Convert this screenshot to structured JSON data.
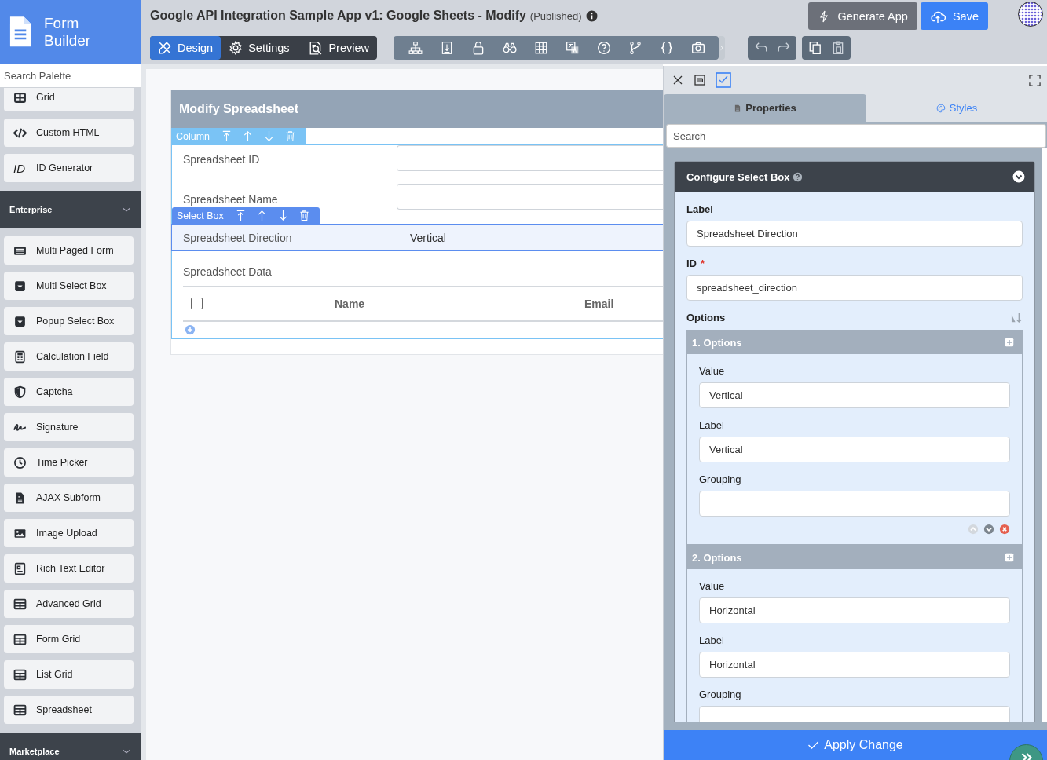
{
  "sidebar": {
    "title": "Form Builder",
    "search_placeholder": "Search Palette",
    "items": [
      {
        "label": "Grid",
        "kind": "grid"
      },
      {
        "label": "Custom HTML",
        "kind": "code"
      },
      {
        "label": "ID Generator",
        "kind": "text",
        "icon_text": "ID"
      }
    ],
    "sections": [
      {
        "title": "Enterprise",
        "expanded": true,
        "items": [
          {
            "label": "Multi Paged Form",
            "kind": "pages"
          },
          {
            "label": "Multi Select Box",
            "kind": "dropdown"
          },
          {
            "label": "Popup Select Box",
            "kind": "dropdown"
          },
          {
            "label": "Calculation Field",
            "kind": "calculator"
          },
          {
            "label": "Captcha",
            "kind": "shield"
          },
          {
            "label": "Signature",
            "kind": "signature"
          },
          {
            "label": "Time Picker",
            "kind": "clock"
          },
          {
            "label": "AJAX Subform",
            "kind": "file"
          },
          {
            "label": "Image Upload",
            "kind": "image"
          },
          {
            "label": "Rich Text Editor",
            "kind": "richtext"
          },
          {
            "label": "Advanced Grid",
            "kind": "table"
          },
          {
            "label": "Form Grid",
            "kind": "table"
          },
          {
            "label": "List Grid",
            "kind": "table"
          },
          {
            "label": "Spreadsheet",
            "kind": "table"
          }
        ]
      },
      {
        "title": "Marketplace",
        "expanded": true
      }
    ]
  },
  "topbar": {
    "title": "Google API Integration Sample App v1: Google Sheets - Modify",
    "status": "(Published)",
    "actions": [
      {
        "label": "Generate App",
        "kind": "generate"
      },
      {
        "label": "Save",
        "kind": "save"
      }
    ],
    "mode_tabs": [
      {
        "label": "Design",
        "kind": "design",
        "selected": true
      },
      {
        "label": "Settings",
        "kind": "settings",
        "selected": false
      },
      {
        "label": "Preview",
        "kind": "preview",
        "selected": false
      }
    ]
  },
  "canvas": {
    "panel_title": "Modify Spreadsheet",
    "column_toolbar": "Column",
    "field_toolbar": "Select Box",
    "fields": [
      {
        "label": "Spreadsheet ID",
        "kind": "text",
        "selected": false
      },
      {
        "label": "Spreadsheet Name",
        "kind": "text",
        "selected": false
      },
      {
        "label": "Spreadsheet Direction",
        "kind": "select",
        "value": "Vertical",
        "selected": true
      },
      {
        "label": "Spreadsheet Data",
        "kind": "grid",
        "columns": [
          "Name",
          "Email"
        ],
        "select_all_checked": false,
        "selected": false
      }
    ]
  },
  "properties": {
    "tabs": [
      {
        "label": "Properties",
        "kind": "properties",
        "selected": true
      },
      {
        "label": "Styles",
        "kind": "styles",
        "selected": false
      }
    ],
    "search_placeholder": "Search",
    "card_title": "Configure Select Box",
    "fields": [
      {
        "label": "Label",
        "value": "Spreadsheet Direction"
      },
      {
        "label": "ID",
        "required_mark": "*",
        "value": "spreadsheet_direction"
      }
    ],
    "options_label": "Options",
    "options": [
      {
        "title": "1. Options",
        "can_move_up": false,
        "can_move_down": true,
        "fields": [
          {
            "label": "Value",
            "value": "Vertical"
          },
          {
            "label": "Label",
            "value": "Vertical"
          },
          {
            "label": "Grouping"
          }
        ]
      },
      {
        "title": "2. Options",
        "fields": [
          {
            "label": "Value",
            "value": "Horizontal"
          },
          {
            "label": "Label",
            "value": "Horizontal"
          },
          {
            "label": "Grouping"
          }
        ]
      }
    ],
    "apply_label": "Apply Change"
  }
}
